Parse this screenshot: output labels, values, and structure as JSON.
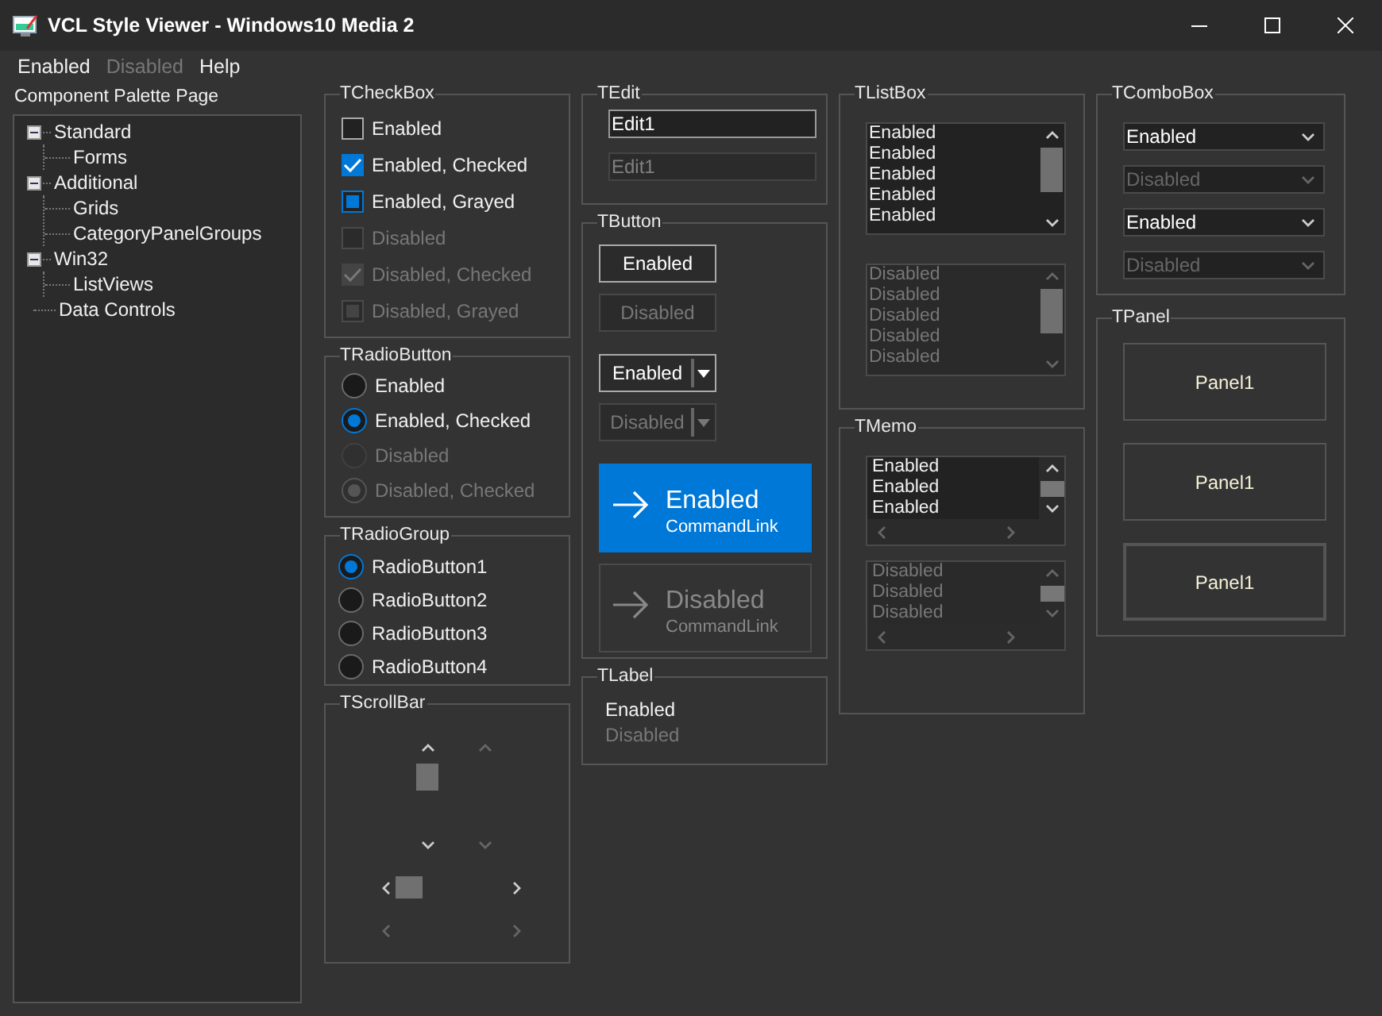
{
  "window": {
    "title": "VCL Style Viewer - Windows10 Media 2"
  },
  "menu": [
    {
      "label": "Enabled",
      "disabled": false
    },
    {
      "label": "Disabled",
      "disabled": true
    },
    {
      "label": "Help",
      "disabled": false
    }
  ],
  "palette": {
    "label": "Component Palette Page",
    "tree": [
      {
        "label": "Standard",
        "expanded": true,
        "children": [
          {
            "label": "Forms"
          }
        ]
      },
      {
        "label": "Additional",
        "expanded": true,
        "children": [
          {
            "label": "Grids"
          },
          {
            "label": "CategoryPanelGroups"
          }
        ]
      },
      {
        "label": "Win32",
        "expanded": true,
        "children": [
          {
            "label": "ListViews"
          }
        ]
      },
      {
        "label": "Data Controls"
      }
    ]
  },
  "columns": [
    {
      "groups": [
        {
          "kind": "checkbox",
          "title": "TCheckBox",
          "items": [
            {
              "label": "Enabled",
              "checked": false,
              "grayed": false,
              "disabled": false
            },
            {
              "label": "Enabled, Checked",
              "checked": true,
              "grayed": false,
              "disabled": false
            },
            {
              "label": "Enabled, Grayed",
              "checked": false,
              "grayed": true,
              "disabled": false
            },
            {
              "label": "Disabled",
              "checked": false,
              "grayed": false,
              "disabled": true
            },
            {
              "label": "Disabled, Checked",
              "checked": true,
              "grayed": false,
              "disabled": true
            },
            {
              "label": "Disabled, Grayed",
              "checked": false,
              "grayed": true,
              "disabled": true
            }
          ]
        },
        {
          "kind": "radio",
          "title": "TRadioButton",
          "items": [
            {
              "label": "Enabled",
              "checked": false,
              "disabled": false
            },
            {
              "label": "Enabled, Checked",
              "checked": true,
              "disabled": false
            },
            {
              "label": "Disabled",
              "checked": false,
              "disabled": true
            },
            {
              "label": "Disabled, Checked",
              "checked": true,
              "disabled": true
            }
          ]
        },
        {
          "kind": "radiogroup",
          "title": "TRadioGroup",
          "items": [
            {
              "label": "RadioButton1",
              "selected": true
            },
            {
              "label": "RadioButton2",
              "selected": false
            },
            {
              "label": "RadioButton3",
              "selected": false
            },
            {
              "label": "RadioButton4",
              "selected": false
            }
          ]
        },
        {
          "kind": "scrollbar",
          "title": "TScrollBar",
          "items": [
            {
              "kind": "vertical",
              "disabled": false
            },
            {
              "kind": "vertical",
              "disabled": true
            },
            {
              "kind": "horizontal",
              "disabled": false
            },
            {
              "kind": "horizontal",
              "disabled": true
            }
          ]
        }
      ]
    },
    {
      "groups": [
        {
          "kind": "edit",
          "title": "TEdit",
          "items": [
            {
              "value": "Edit1",
              "disabled": false
            },
            {
              "value": "Edit1",
              "disabled": true
            }
          ]
        },
        {
          "kind": "button",
          "title": "TButton",
          "items": [
            {
              "kind": "push",
              "label": "Enabled",
              "disabled": false
            },
            {
              "kind": "push",
              "label": "Disabled",
              "disabled": true
            },
            {
              "kind": "split",
              "label": "Enabled",
              "disabled": false
            },
            {
              "kind": "split",
              "label": "Disabled",
              "disabled": true
            },
            {
              "kind": "commandlink",
              "label": "Enabled",
              "note": "CommandLink",
              "disabled": false
            },
            {
              "kind": "commandlink",
              "label": "Disabled",
              "note": "CommandLink",
              "disabled": true
            }
          ]
        },
        {
          "kind": "label",
          "title": "TLabel",
          "items": [
            {
              "text": "Enabled",
              "disabled": false
            },
            {
              "text": "Disabled",
              "disabled": true
            }
          ]
        }
      ]
    },
    {
      "groups": [
        {
          "kind": "listbox",
          "title": "TListBox",
          "items": [
            {
              "lines": [
                "Enabled",
                "Enabled",
                "Enabled",
                "Enabled",
                "Enabled"
              ],
              "disabled": false
            },
            {
              "lines": [
                "Disabled",
                "Disabled",
                "Disabled",
                "Disabled",
                "Disabled"
              ],
              "disabled": true
            }
          ]
        },
        {
          "kind": "memo",
          "title": "TMemo",
          "items": [
            {
              "lines": [
                "Enabled",
                "Enabled",
                "Enabled"
              ],
              "disabled": false
            },
            {
              "lines": [
                "Disabled",
                "Disabled",
                "Disabled"
              ],
              "disabled": true
            }
          ]
        }
      ]
    },
    {
      "groups": [
        {
          "kind": "combobox",
          "title": "TComboBox",
          "items": [
            {
              "value": "Enabled",
              "disabled": false
            },
            {
              "value": "Disabled",
              "disabled": true
            },
            {
              "value": "Enabled",
              "disabled": false
            },
            {
              "value": "Disabled",
              "disabled": true
            }
          ]
        },
        {
          "kind": "panel",
          "title": "TPanel",
          "items": [
            {
              "label": "Panel1",
              "kind": "thin"
            },
            {
              "label": "Panel1",
              "kind": "thin"
            },
            {
              "label": "Panel1",
              "kind": "thick"
            }
          ]
        }
      ]
    }
  ]
}
